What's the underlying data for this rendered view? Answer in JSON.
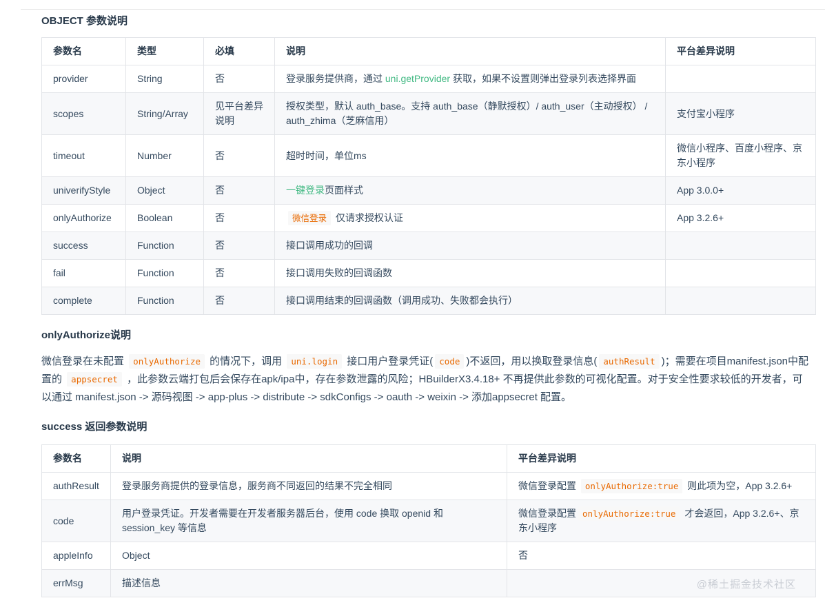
{
  "colors": {
    "accent_green": "#42b983",
    "code_orange": "#e96900",
    "watermark_gray": "#c9cdd4"
  },
  "page": {
    "watermark": "@稀土掘金技术社区"
  },
  "sections": {
    "object_params": {
      "heading": "OBJECT 参数说明",
      "table": {
        "headers": [
          "参数名",
          "类型",
          "必填",
          "说明",
          "平台差异说明"
        ],
        "rows": [
          [
            [
              {
                "type": "text",
                "text": "provider"
              }
            ],
            [
              {
                "type": "text",
                "text": "String"
              }
            ],
            [
              {
                "type": "text",
                "text": "否"
              }
            ],
            [
              {
                "type": "text",
                "text": "登录服务提供商，通过 "
              },
              {
                "type": "link",
                "text": "uni.getProvider"
              },
              {
                "type": "text",
                "text": " 获取，如果不设置则弹出登录列表选择界面"
              }
            ],
            []
          ],
          [
            [
              {
                "type": "text",
                "text": "scopes"
              }
            ],
            [
              {
                "type": "text",
                "text": "String/Array"
              }
            ],
            [
              {
                "type": "text",
                "text": "见平台差异说明"
              }
            ],
            [
              {
                "type": "text",
                "text": "授权类型，默认 auth_base。支持 auth_base（静默授权）/ auth_user（主动授权） / auth_zhima（芝麻信用）"
              }
            ],
            [
              {
                "type": "text",
                "text": "支付宝小程序"
              }
            ]
          ],
          [
            [
              {
                "type": "text",
                "text": "timeout"
              }
            ],
            [
              {
                "type": "text",
                "text": "Number"
              }
            ],
            [
              {
                "type": "text",
                "text": "否"
              }
            ],
            [
              {
                "type": "text",
                "text": "超时时间，单位ms"
              }
            ],
            [
              {
                "type": "text",
                "text": "微信小程序、百度小程序、京东小程序"
              }
            ]
          ],
          [
            [
              {
                "type": "text",
                "text": "univerifyStyle"
              }
            ],
            [
              {
                "type": "text",
                "text": "Object"
              }
            ],
            [
              {
                "type": "text",
                "text": "否"
              }
            ],
            [
              {
                "type": "link",
                "text": "一键登录"
              },
              {
                "type": "text",
                "text": "页面样式"
              }
            ],
            [
              {
                "type": "text",
                "text": "App 3.0.0+"
              }
            ]
          ],
          [
            [
              {
                "type": "text",
                "text": "onlyAuthorize"
              }
            ],
            [
              {
                "type": "text",
                "text": "Boolean"
              }
            ],
            [
              {
                "type": "text",
                "text": "否"
              }
            ],
            [
              {
                "type": "code",
                "text": "微信登录"
              },
              {
                "type": "text",
                "text": " 仅请求授权认证"
              }
            ],
            [
              {
                "type": "text",
                "text": "App 3.2.6+"
              }
            ]
          ],
          [
            [
              {
                "type": "text",
                "text": "success"
              }
            ],
            [
              {
                "type": "text",
                "text": "Function"
              }
            ],
            [
              {
                "type": "text",
                "text": "否"
              }
            ],
            [
              {
                "type": "text",
                "text": "接口调用成功的回调"
              }
            ],
            []
          ],
          [
            [
              {
                "type": "text",
                "text": "fail"
              }
            ],
            [
              {
                "type": "text",
                "text": "Function"
              }
            ],
            [
              {
                "type": "text",
                "text": "否"
              }
            ],
            [
              {
                "type": "text",
                "text": "接口调用失败的回调函数"
              }
            ],
            []
          ],
          [
            [
              {
                "type": "text",
                "text": "complete"
              }
            ],
            [
              {
                "type": "text",
                "text": "Function"
              }
            ],
            [
              {
                "type": "text",
                "text": "否"
              }
            ],
            [
              {
                "type": "text",
                "text": "接口调用结束的回调函数（调用成功、失败都会执行）"
              }
            ],
            []
          ]
        ]
      }
    },
    "only_authorize": {
      "heading": "onlyAuthorize说明",
      "paragraph": [
        {
          "type": "text",
          "text": "微信登录在未配置 "
        },
        {
          "type": "code",
          "text": "onlyAuthorize"
        },
        {
          "type": "text",
          "text": " 的情况下，调用 "
        },
        {
          "type": "code",
          "text": "uni.login"
        },
        {
          "type": "text",
          "text": " 接口用户登录凭证("
        },
        {
          "type": "code",
          "text": "code"
        },
        {
          "type": "text",
          "text": ")不返回，用以换取登录信息("
        },
        {
          "type": "code",
          "text": "authResult"
        },
        {
          "type": "text",
          "text": ")；需要在项目manifest.json中配置的 "
        },
        {
          "type": "code",
          "text": "appsecret"
        },
        {
          "type": "text",
          "text": " ，此参数云端打包后会保存在apk/ipa中，存在参数泄露的风险；HBuilderX3.4.18+ 不再提供此参数的可视化配置。对于安全性要求较低的开发者，可以通过 manifest.json -> 源码视图 -> app-plus -> distribute -> sdkConfigs -> oauth -> weixin -> 添加appsecret 配置。"
        }
      ]
    },
    "success_params": {
      "heading": "success 返回参数说明",
      "table": {
        "headers": [
          "参数名",
          "说明",
          "平台差异说明"
        ],
        "rows": [
          [
            [
              {
                "type": "text",
                "text": "authResult"
              }
            ],
            [
              {
                "type": "text",
                "text": "登录服务商提供的登录信息，服务商不同返回的结果不完全相同"
              }
            ],
            [
              {
                "type": "text",
                "text": "微信登录配置 "
              },
              {
                "type": "code",
                "text": "onlyAuthorize:true"
              },
              {
                "type": "text",
                "text": " 则此项为空，App 3.2.6+"
              }
            ]
          ],
          [
            [
              {
                "type": "text",
                "text": "code"
              }
            ],
            [
              {
                "type": "text",
                "text": "用户登录凭证。开发者需要在开发者服务器后台，使用 code 换取 openid 和 session_key 等信息"
              }
            ],
            [
              {
                "type": "text",
                "text": "微信登录配置"
              },
              {
                "type": "code",
                "text": "onlyAuthorize:true"
              },
              {
                "type": "text",
                "text": " 才会返回，App 3.2.6+、京东小程序"
              }
            ]
          ],
          [
            [
              {
                "type": "text",
                "text": "appleInfo"
              }
            ],
            [
              {
                "type": "text",
                "text": "Object"
              }
            ],
            [
              {
                "type": "text",
                "text": "否"
              }
            ]
          ],
          [
            [
              {
                "type": "text",
                "text": "errMsg"
              }
            ],
            [
              {
                "type": "text",
                "text": "描述信息"
              }
            ],
            []
          ]
        ]
      }
    }
  }
}
